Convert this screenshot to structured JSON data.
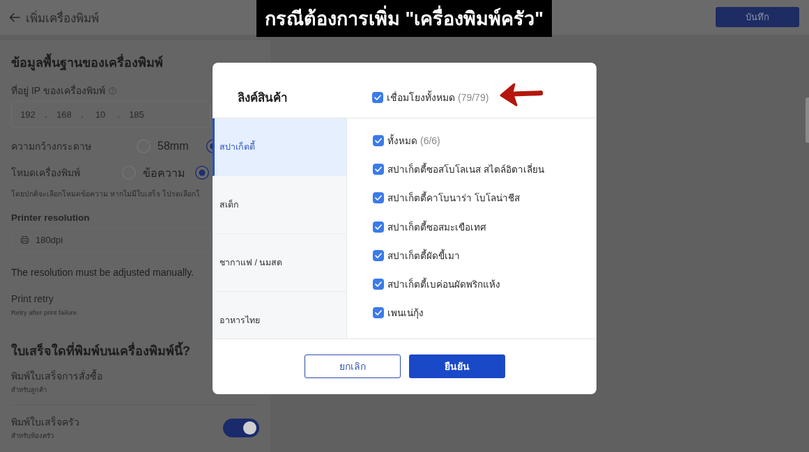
{
  "caption": "กรณีต้องการเพิ่ม \"เครื่องพิมพ์ครัว\"",
  "header": {
    "title": "เพิ่มเครื่องพิมพ์",
    "save_button": "บันทึก"
  },
  "basic_info": {
    "heading": "ข้อมูลพื้นฐานของเครื่องพิมพ์",
    "ip_label": "ที่อยู่ IP ของเครื่องพิมพ์",
    "ip_segments": [
      "192",
      "168",
      "10",
      "185"
    ],
    "ip_separators": [
      ".",
      ".",
      "."
    ],
    "paper_width": {
      "label": "ความกว้างกระดาษ",
      "options": [
        {
          "label": "58mm",
          "selected": false
        },
        {
          "selected": true
        }
      ]
    },
    "printer_mode": {
      "label": "โหมดเครื่องพิมพ์",
      "options": [
        {
          "label": "ข้อความ",
          "selected": false
        },
        {
          "selected": true
        }
      ],
      "hint": "โดยปกติจะเลือกโหมดข้อความ หากไม่มีใบเสร็จ โปรดเลือกโ"
    },
    "resolution": {
      "label": "Printer resolution",
      "value": "180dpi",
      "note": "The resolution must be adjusted manually."
    },
    "print_retry": {
      "label": "Print retry",
      "description": "Retry after print failure"
    }
  },
  "receipts": {
    "heading": "ใบเสร็จใดที่พิมพ์บนเครื่องพิมพ์นี้?",
    "order_receipt": {
      "label": "พิมพ์ใบเสร็จการสั่งซื้อ",
      "description": "สำหรับลูกค้า"
    },
    "kitchen_receipt": {
      "label": "พิมพ์ใบเสร็จครัว",
      "description": "สำหรับห้องครัว",
      "on": true
    }
  },
  "dialog": {
    "title": "ลิงค์สินค้า",
    "link_all": {
      "label": "เชื่อมโยงทั้งหมด",
      "count": "(79/79)",
      "checked": true
    },
    "categories": [
      {
        "label": "สปาเก็ตตี้",
        "selected": true
      },
      {
        "label": "สเต็ก",
        "selected": false
      },
      {
        "label": "ชากาแฟ / นมสด",
        "selected": false
      },
      {
        "label": "อาหารไทย",
        "selected": false
      }
    ],
    "products": [
      {
        "label": "ทั้งหมด",
        "count": "(6/6)",
        "checked": true
      },
      {
        "label": "สปาเก็ตตี้ซอสโบโลเนส สไตล์อิตาเลี่ยน",
        "checked": true
      },
      {
        "label": "สปาเก็ตตี้คาโบนาร่า โบโลน่าชีส",
        "checked": true
      },
      {
        "label": "สปาเก็ตตี้ซอสมะเขือเทศ",
        "checked": true
      },
      {
        "label": "สปาเก็ตตี้ผัดขี้เมา",
        "checked": true
      },
      {
        "label": "สปาเก็ตตี้เบค่อนผัดพริกแห้ง",
        "checked": true
      },
      {
        "label": "เพนเน่กุ้ง",
        "checked": true
      }
    ],
    "buttons": [
      {
        "label": "ยกเลิก",
        "kind": "secondary"
      },
      {
        "label": "ยืนยัน",
        "kind": "primary"
      }
    ]
  }
}
